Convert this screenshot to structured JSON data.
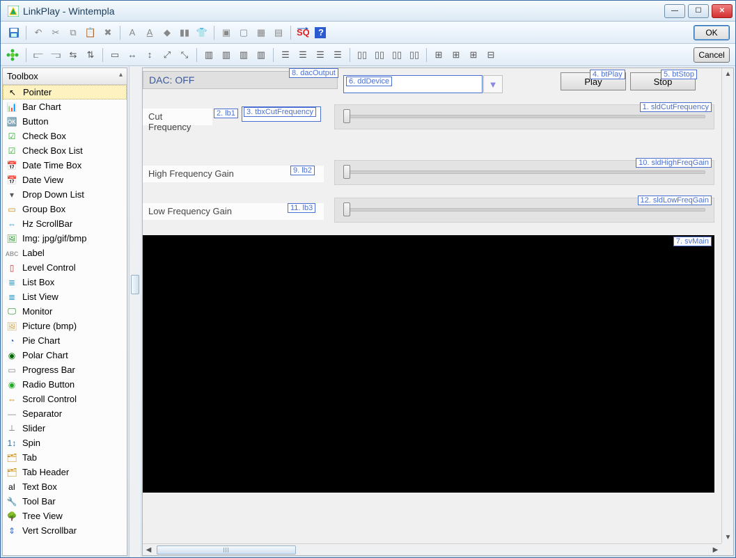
{
  "window": {
    "title": "LinkPlay   -   Wintempla"
  },
  "dialogButtons": {
    "ok": "OK",
    "cancel": "Cancel"
  },
  "sidebar": {
    "header": "Toolbox",
    "items": [
      {
        "label": "Pointer"
      },
      {
        "label": "Bar Chart"
      },
      {
        "label": "Button"
      },
      {
        "label": "Check Box"
      },
      {
        "label": "Check Box List"
      },
      {
        "label": "Date Time Box"
      },
      {
        "label": "Date View"
      },
      {
        "label": "Drop Down List"
      },
      {
        "label": "Group Box"
      },
      {
        "label": "Hz ScrollBar"
      },
      {
        "label": "Img: jpg/gif/bmp"
      },
      {
        "label": "Label"
      },
      {
        "label": "Level Control"
      },
      {
        "label": "List Box"
      },
      {
        "label": "List View"
      },
      {
        "label": "Monitor"
      },
      {
        "label": "Picture (bmp)"
      },
      {
        "label": "Pie Chart"
      },
      {
        "label": "Polar Chart"
      },
      {
        "label": "Progress Bar"
      },
      {
        "label": "Radio Button"
      },
      {
        "label": "Scroll Control"
      },
      {
        "label": "Separator"
      },
      {
        "label": "Slider"
      },
      {
        "label": "Spin"
      },
      {
        "label": "Tab"
      },
      {
        "label": "Tab Header"
      },
      {
        "label": "Text Box"
      },
      {
        "label": "Tool Bar"
      },
      {
        "label": "Tree View"
      },
      {
        "label": "Vert Scrollbar"
      }
    ]
  },
  "design": {
    "dac": "DAC: OFF",
    "play": "Play",
    "stop": "Stop",
    "cutFreq": "Cut Frequency",
    "highFreq": "High Frequency Gain",
    "lowFreq": "Low Frequency Gain"
  },
  "tags": {
    "dacOutput": "8. dacOutput",
    "ddDevice": "6. ddDevice",
    "btPlay": "4. btPlay",
    "btStop": "5. btStop",
    "lb1": "2. lb1",
    "tbxCutFrequency": "3. tbxCutFrequency",
    "sldCutFrequency": "1. sldCutFrequency",
    "lb2": "9. lb2",
    "sldHighFreqGain": "10. sldHighFreqGain",
    "lb3": "11. lb3",
    "sldLowFreqGain": "12. sldLowFreqGain",
    "svMain": "7. svMain"
  }
}
